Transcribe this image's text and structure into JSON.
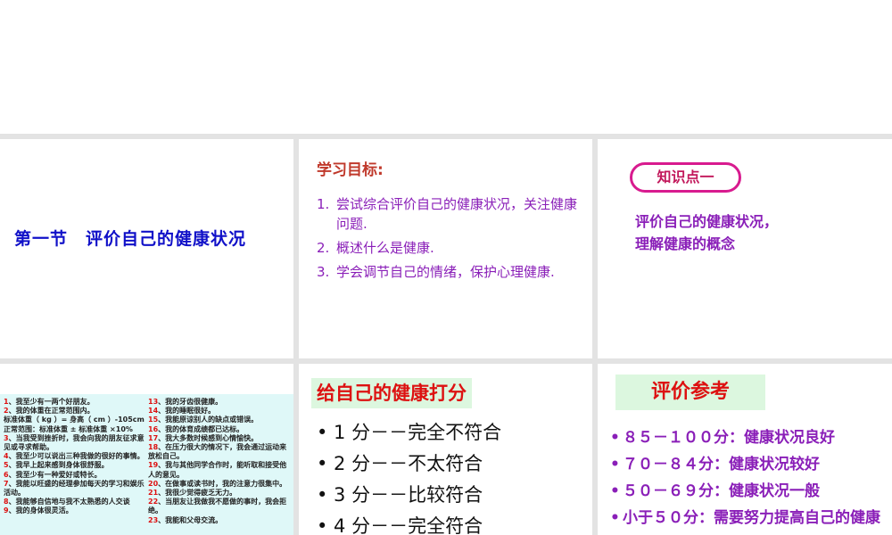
{
  "slide1": {
    "title": "第一节　评价自己的健康状况"
  },
  "slide2": {
    "heading": "学习目标:",
    "items": [
      {
        "num": "1.",
        "text": "尝试综合评价自己的健康状况，关注健康问题."
      },
      {
        "num": "2.",
        "text": "概述什么是健康."
      },
      {
        "num": "3.",
        "text": "学会调节自己的情绪，保护心理健康."
      }
    ]
  },
  "slide3": {
    "badge": "知识点一",
    "text": "评价自己的健康状况，理解健康的概念"
  },
  "slide4": {
    "col1": [
      {
        "n": "1",
        "t": "、我至少有一两个好朋友。"
      },
      {
        "n": "2",
        "t": "、我的体重在正常范围内。"
      },
      {
        "n": "",
        "t": "标准体重（ kg ）= 身高（ cm ）-105cm"
      },
      {
        "n": "",
        "t": "正常范围：标准体重 ± 标准体重 ×10%"
      },
      {
        "n": "3",
        "t": "、当我受到挫折时，我会向我的朋友征求意见或寻求帮助。"
      },
      {
        "n": "4",
        "t": "、我至少可以说出三种我做的很好的事情。"
      },
      {
        "n": "5",
        "t": "、我早上起来感到身体很舒服。"
      },
      {
        "n": "6",
        "t": "、我至少有一种爱好或特长。"
      },
      {
        "n": "7",
        "t": "、我能以旺盛的经理参加每天的学习和娱乐活动。"
      },
      {
        "n": "8",
        "t": "、我能够自信地与我不太熟悉的人交谈"
      },
      {
        "n": "9",
        "t": "、我的身体很灵活。"
      }
    ],
    "col2": [
      {
        "n": "13",
        "t": "、我的牙齿很健康。"
      },
      {
        "n": "14",
        "t": "、我的睡眠很好。"
      },
      {
        "n": "15",
        "t": "、我能原谅别人的缺点或错误。"
      },
      {
        "n": "16",
        "t": "、我的体育成绩都已达标。"
      },
      {
        "n": "17",
        "t": "、我大多数时候感到心情愉快。"
      },
      {
        "n": "18",
        "t": "、在压力很大的情况下，我会通过运动来放松自己。"
      },
      {
        "n": "19",
        "t": "、我与其他同学合作时，能听取和接受他人的意见。"
      },
      {
        "n": "20",
        "t": "、在做事或读书时，我的注意力很集中。"
      },
      {
        "n": "21",
        "t": "、我很少觉得疲乏无力。"
      },
      {
        "n": "22",
        "t": "、当朋友让我做我不愿做的事时，我会拒绝。"
      },
      {
        "n": "23",
        "t": "、我能和父母交流。"
      }
    ]
  },
  "slide5": {
    "title": "给自己的健康打分",
    "items": [
      "• 1 分－－完全不符合",
      "• 2 分－－不太符合",
      "• 3 分－－比较符合",
      "• 4 分－－完全符合"
    ]
  },
  "slide6": {
    "title": "评价参考",
    "items": [
      "８５－１００分：健康状况良好",
      "７０－８４分：健康状况较好",
      "５０－６９分：健康状况一般",
      "小于５０分：需要努力提高自己的健康状况"
    ]
  },
  "colors": {
    "blue_title": "#1010c8",
    "purple_text": "#8a1fb8",
    "red_heading": "#d11111",
    "badge_border": "#d81b8f",
    "highlight_bg": "#dcf7df",
    "questionnaire_bg": "#dff8f8"
  }
}
